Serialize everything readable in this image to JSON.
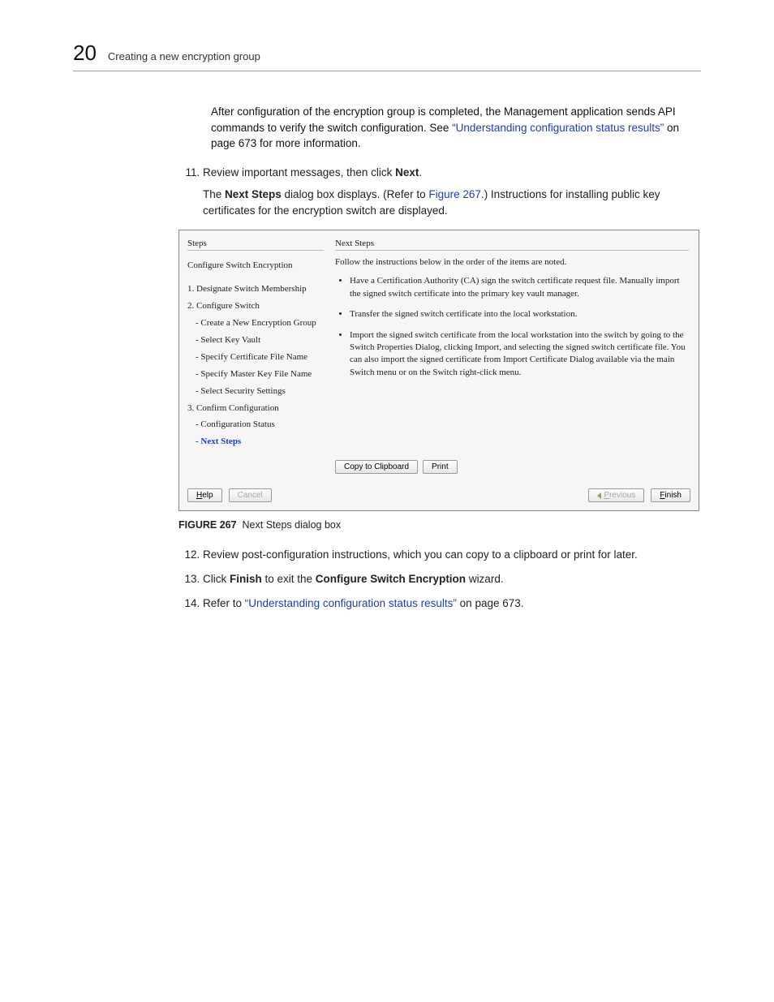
{
  "header": {
    "chapter_num": "20",
    "title": "Creating a new encryption group"
  },
  "intro": {
    "text_before_link": "After configuration of the encryption group is completed, the Management application sends API commands to verify the switch configuration. See ",
    "link_text": "“Understanding configuration status results”",
    "text_after_link": " on page 673 for more information."
  },
  "steps": {
    "s11": {
      "text_before_bold": "Review important messages, then click ",
      "bold": "Next",
      "text_after_bold": "."
    },
    "s11_sub": {
      "a": "The ",
      "b": "Next Steps",
      "c": " dialog box displays. (Refer to ",
      "link": "Figure 267",
      "d": ".) Instructions for installing public key certificates for the encryption switch are displayed."
    },
    "s12": "Review post-configuration instructions, which you can copy to a clipboard or print for later.",
    "s13": {
      "a": "Click ",
      "b": "Finish",
      "c": " to exit the ",
      "d": "Configure Switch Encryption",
      "e": " wizard."
    },
    "s14": {
      "a": "Refer to ",
      "link": "“Understanding configuration status results”",
      "b": " on page 673."
    }
  },
  "dialog": {
    "left_header": "Steps",
    "left_title": "Configure Switch Encryption",
    "steps_list": {
      "s1": "1. Designate Switch Membership",
      "s2": "2. Configure Switch",
      "s2a": "- Create a New Encryption Group",
      "s2b": "- Select Key Vault",
      "s2c": "- Specify Certificate File Name",
      "s2d": "- Specify Master Key File Name",
      "s2e": "- Select Security Settings",
      "s3": "3. Confirm Configuration",
      "s3a": "- Configuration Status",
      "s3b": "- Next Steps"
    },
    "right_header": "Next Steps",
    "right_intro": "Follow the instructions below in the order of the items are noted.",
    "bullets": {
      "b1": "Have a Certification Authority (CA) sign the switch certificate request file. Manually import the signed switch certificate into the primary key vault manager.",
      "b2": "Transfer the signed switch certificate into the local workstation.",
      "b3": "Import the signed switch certificate from the local workstation into the switch by going to the Switch Properties Dialog, clicking Import, and selecting the signed switch certificate file. You can also import the signed certificate from Import Certificate Dialog available via the main Switch menu or on the Switch right-click menu."
    },
    "buttons": {
      "copy": "Copy to Clipboard",
      "print": "Print",
      "help": "Help",
      "cancel": "Cancel",
      "previous": "Previous",
      "finish": "Finish"
    }
  },
  "figure": {
    "label": "FIGURE 267",
    "caption": "Next Steps dialog box"
  }
}
